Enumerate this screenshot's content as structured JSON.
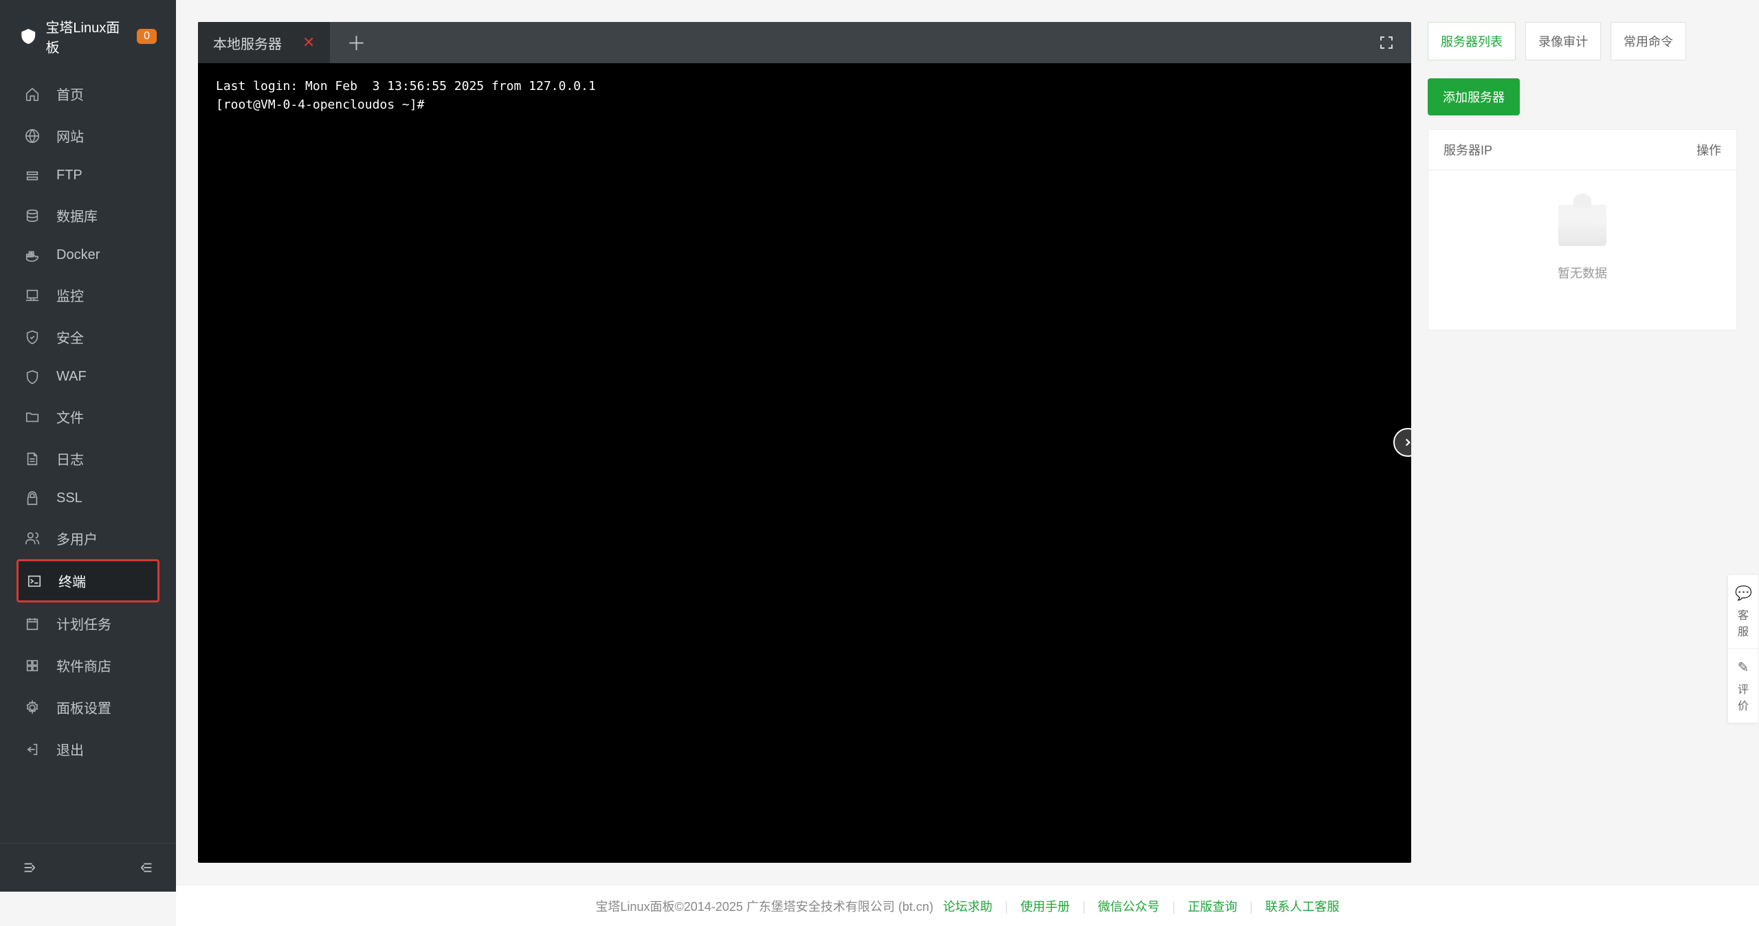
{
  "app": {
    "title": "宝塔Linux面板",
    "badge": "0"
  },
  "sidebar": {
    "items": [
      {
        "label": "首页",
        "icon": "home-icon"
      },
      {
        "label": "网站",
        "icon": "globe-icon"
      },
      {
        "label": "FTP",
        "icon": "ftp-icon"
      },
      {
        "label": "数据库",
        "icon": "database-icon"
      },
      {
        "label": "Docker",
        "icon": "docker-icon"
      },
      {
        "label": "监控",
        "icon": "monitor-icon"
      },
      {
        "label": "安全",
        "icon": "shield-icon"
      },
      {
        "label": "WAF",
        "icon": "waf-icon"
      },
      {
        "label": "文件",
        "icon": "folder-icon"
      },
      {
        "label": "日志",
        "icon": "log-icon"
      },
      {
        "label": "SSL",
        "icon": "ssl-icon"
      },
      {
        "label": "多用户",
        "icon": "users-icon"
      },
      {
        "label": "终端",
        "icon": "terminal-icon"
      },
      {
        "label": "计划任务",
        "icon": "calendar-icon"
      },
      {
        "label": "软件商店",
        "icon": "apps-icon"
      },
      {
        "label": "面板设置",
        "icon": "gear-icon"
      },
      {
        "label": "退出",
        "icon": "exit-icon"
      }
    ],
    "active_index": 12
  },
  "terminal": {
    "tab_label": "本地服务器",
    "output": "Last login: Mon Feb  3 13:56:55 2025 from 127.0.0.1\n[root@VM-0-4-opencloudos ~]#"
  },
  "panel": {
    "tabs": [
      "服务器列表",
      "录像审计",
      "常用命令"
    ],
    "active_tab": 0,
    "add_button": "添加服务器",
    "col_ip": "服务器IP",
    "col_action": "操作",
    "empty": "暂无数据"
  },
  "footer": {
    "copyright": "宝塔Linux面板©2014-2025 广东堡塔安全技术有限公司 (bt.cn)",
    "links": [
      "论坛求助",
      "使用手册",
      "微信公众号",
      "正版查询",
      "联系人工客服"
    ]
  },
  "float": {
    "service": "客服",
    "feedback": "评价"
  }
}
